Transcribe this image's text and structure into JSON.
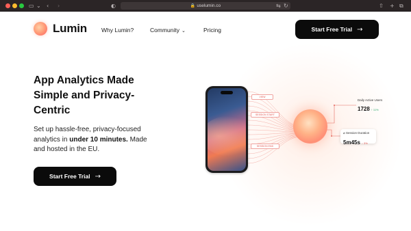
{
  "browser": {
    "url": "uselumin.co",
    "icons": {
      "sidebar": "sidebar-icon",
      "back": "chevron-left-icon",
      "forward": "chevron-right-icon",
      "privacy": "shield-icon",
      "lock": "lock-icon",
      "translate": "translate-icon",
      "reload": "reload-icon",
      "share": "share-icon",
      "new_tab": "plus-icon",
      "tabs": "tab-overview-icon"
    }
  },
  "nav": {
    "brand": "Lumin",
    "links": [
      {
        "label": "Why Lumin?"
      },
      {
        "label": "Community",
        "has_dropdown": true
      },
      {
        "label": "Pricing"
      }
    ],
    "cta_label": "Start Free Trial"
  },
  "hero": {
    "headline": "App Analytics Made Simple and Privacy-Centric",
    "subtext_before": "Set up hassle-free, privacy-focused analytics in ",
    "subtext_bold": "under 10 minutes.",
    "subtext_after": " Made and hosted in the EU.",
    "cta_label": "Start Free Trial"
  },
  "illustration": {
    "events": [
      "VIEW",
      "SESSION START",
      "SESSION END"
    ],
    "stats": {
      "daily_active_users": {
        "label": "Daily Active Users",
        "value": "1728",
        "change": "↑ 11%"
      },
      "session_duration": {
        "label": "⌀ Session Duration",
        "value": "5m45s",
        "change": "↓ 3%"
      }
    }
  },
  "colors": {
    "cta_bg": "#0b0b0b",
    "accent": "#ff8f76",
    "browser_bar": "#2b2526"
  }
}
